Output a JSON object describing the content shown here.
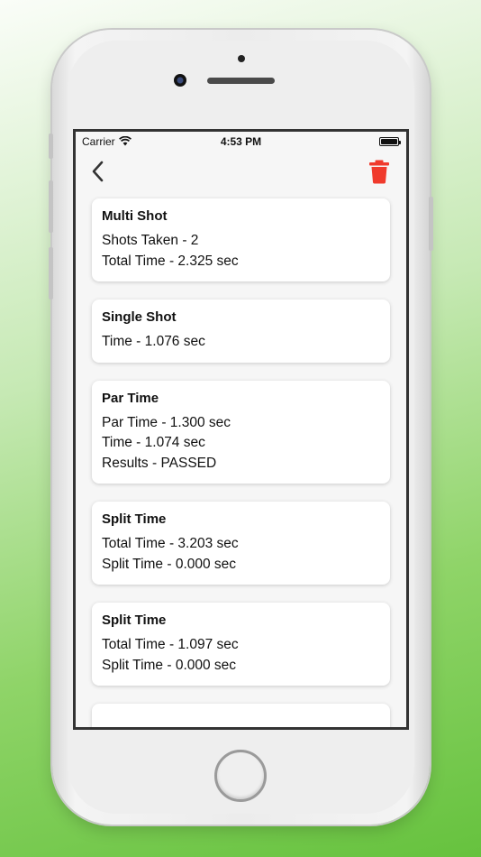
{
  "status_bar": {
    "carrier": "Carrier",
    "time": "4:53 PM"
  },
  "nav": {
    "back_icon": "chevron-left-icon",
    "delete_icon": "trash-icon",
    "delete_color": "#f03a2c"
  },
  "records": [
    {
      "title": "Multi Shot",
      "lines": [
        "Shots Taken - 2",
        "Total Time - 2.325 sec"
      ]
    },
    {
      "title": "Single Shot",
      "lines": [
        "Time - 1.076 sec"
      ]
    },
    {
      "title": "Par Time",
      "lines": [
        "Par Time - 1.300 sec",
        "Time - 1.074 sec",
        "Results - PASSED"
      ]
    },
    {
      "title": "Split Time",
      "lines": [
        "Total Time - 3.203 sec",
        "Split Time - 0.000 sec"
      ]
    },
    {
      "title": "Split Time",
      "lines": [
        "Total Time - 1.097 sec",
        "Split Time - 0.000 sec"
      ]
    }
  ]
}
